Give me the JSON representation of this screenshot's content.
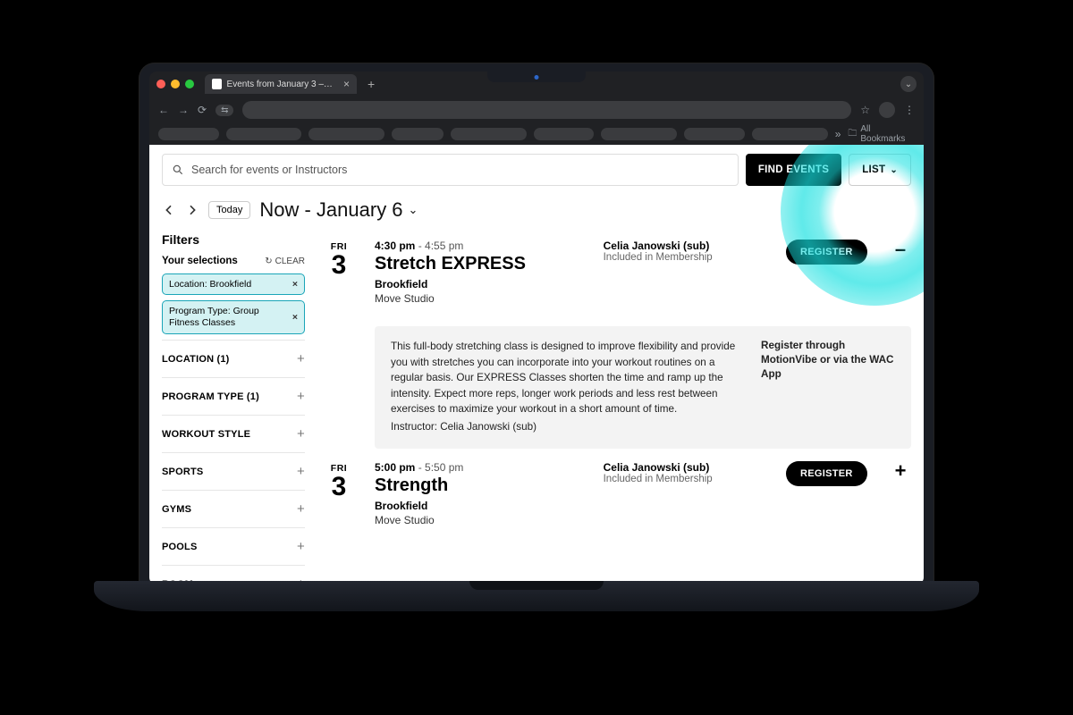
{
  "browser": {
    "tab_title": "Events from January 3 – Jan…",
    "all_bookmarks": "All Bookmarks"
  },
  "search": {
    "placeholder": "Search for events or Instructors",
    "find_events": "FIND EVENTS",
    "view_label": "LIST"
  },
  "nav": {
    "today": "Today",
    "range": "Now - January 6"
  },
  "filters": {
    "title": "Filters",
    "your_selections": "Your selections",
    "clear": "CLEAR",
    "chips": [
      "Location: Brookfield",
      "Program Type: Group Fitness Classes"
    ],
    "groups": [
      "LOCATION (1)",
      "PROGRAM TYPE (1)",
      "WORKOUT STYLE",
      "SPORTS",
      "GYMS",
      "POOLS",
      "ROOM"
    ]
  },
  "events": [
    {
      "dow": "FRI",
      "dnum": "3",
      "start": "4:30 pm",
      "end": "4:55 pm",
      "title": "Stretch EXPRESS",
      "loc": "Brookfield",
      "room": "Move Studio",
      "instructor": "Celia Janowski (sub)",
      "membership": "Included in Membership",
      "register": "REGISTER",
      "expanded": true,
      "detail": "This full-body stretching class is designed to improve flexibility and provide you with stretches you can incorporate into your workout routines on a regular basis. Our EXPRESS Classes shorten the time and ramp up the intensity. Expect more reps, longer work periods and less rest between exercises to maximize your workout in a short amount of time.",
      "detail_instructor": "Instructor: Celia Janowski (sub)",
      "detail_side": "Register through MotionVibe or via the WAC App"
    },
    {
      "dow": "FRI",
      "dnum": "3",
      "start": "5:00 pm",
      "end": "5:50 pm",
      "title": "Strength",
      "loc": "Brookfield",
      "room": "Move Studio",
      "instructor": "Celia Janowski (sub)",
      "membership": "Included in Membership",
      "register": "REGISTER",
      "expanded": false
    }
  ]
}
